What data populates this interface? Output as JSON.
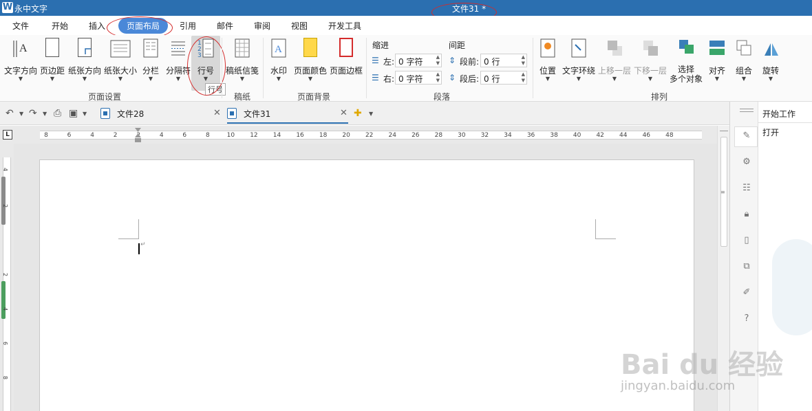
{
  "titlebar": {
    "app_name": "永中文字",
    "doc_title": "文件31 *",
    "logo_letter": "W"
  },
  "menu": {
    "tabs": [
      {
        "label": "文件"
      },
      {
        "label": "开始"
      },
      {
        "label": "插入"
      },
      {
        "label": "页面布局",
        "active": true
      },
      {
        "label": "引用"
      },
      {
        "label": "邮件"
      },
      {
        "label": "审阅"
      },
      {
        "label": "视图"
      },
      {
        "label": "开发工具"
      }
    ]
  },
  "ribbon": {
    "page_setup": {
      "group_label": "页面设置",
      "buttons": [
        "文字方向",
        "页边距",
        "纸张方向",
        "纸张大小",
        "分栏",
        "分隔符",
        "行号"
      ]
    },
    "draft": {
      "group_label": "稿纸",
      "button": "稿纸信笺"
    },
    "background": {
      "group_label": "页面背景",
      "buttons": [
        "水印",
        "页面颜色",
        "页面边框"
      ]
    },
    "paragraph": {
      "group_label": "段落",
      "indent_title": "缩进",
      "spacing_title": "间距",
      "left_label": "左:",
      "left_value": "0 字符",
      "right_label": "右:",
      "right_value": "0 字符",
      "before_label": "段前:",
      "before_value": "0 行",
      "after_label": "段后:",
      "after_value": "0 行"
    },
    "arrange": {
      "group_label": "排列",
      "buttons": [
        "位置",
        "文字环绕",
        "上移一层",
        "下移一层",
        "选择\n多个对象",
        "对齐",
        "组合",
        "旋转"
      ]
    },
    "tooltip": "行号"
  },
  "doc_tabs": [
    {
      "label": "文件28"
    },
    {
      "label": "文件31",
      "active": true
    }
  ],
  "ruler": {
    "h_ticks": [
      "8",
      "6",
      "4",
      "2",
      "2",
      "4",
      "6",
      "8",
      "10",
      "12",
      "14",
      "16",
      "18",
      "20",
      "22",
      "24",
      "26",
      "28",
      "30",
      "32",
      "34",
      "36",
      "38",
      "40",
      "42",
      "44",
      "46",
      "48"
    ],
    "v_ticks": [
      "4",
      "2",
      "2",
      "4",
      "6",
      "8"
    ]
  },
  "sidepanel": {
    "title": "开始工作",
    "open_label": "打开"
  },
  "watermark": {
    "brand": "Bai  du 经验",
    "url": "jingyan.baidu.com"
  },
  "colors": {
    "titlebar": "#2b6fb0",
    "active_tab": "#4a88d8",
    "annotation": "#d42b2b"
  },
  "icons": [
    "undo-icon",
    "redo-icon",
    "print-preview-icon",
    "save-icon",
    "new-doc-icon",
    "pen-icon",
    "settings-icon",
    "layers-icon",
    "lock-icon",
    "clipboard-icon",
    "copy-icon",
    "edit-icon",
    "help-icon"
  ]
}
